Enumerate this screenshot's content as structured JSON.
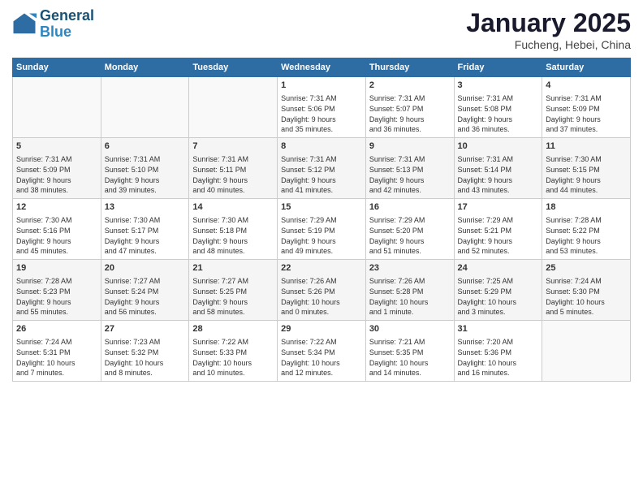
{
  "header": {
    "logo_line1": "General",
    "logo_line2": "Blue",
    "month": "January 2025",
    "location": "Fucheng, Hebei, China"
  },
  "days_of_week": [
    "Sunday",
    "Monday",
    "Tuesday",
    "Wednesday",
    "Thursday",
    "Friday",
    "Saturday"
  ],
  "weeks": [
    [
      {
        "day": "",
        "info": ""
      },
      {
        "day": "",
        "info": ""
      },
      {
        "day": "",
        "info": ""
      },
      {
        "day": "1",
        "info": "Sunrise: 7:31 AM\nSunset: 5:06 PM\nDaylight: 9 hours\nand 35 minutes."
      },
      {
        "day": "2",
        "info": "Sunrise: 7:31 AM\nSunset: 5:07 PM\nDaylight: 9 hours\nand 36 minutes."
      },
      {
        "day": "3",
        "info": "Sunrise: 7:31 AM\nSunset: 5:08 PM\nDaylight: 9 hours\nand 36 minutes."
      },
      {
        "day": "4",
        "info": "Sunrise: 7:31 AM\nSunset: 5:09 PM\nDaylight: 9 hours\nand 37 minutes."
      }
    ],
    [
      {
        "day": "5",
        "info": "Sunrise: 7:31 AM\nSunset: 5:09 PM\nDaylight: 9 hours\nand 38 minutes."
      },
      {
        "day": "6",
        "info": "Sunrise: 7:31 AM\nSunset: 5:10 PM\nDaylight: 9 hours\nand 39 minutes."
      },
      {
        "day": "7",
        "info": "Sunrise: 7:31 AM\nSunset: 5:11 PM\nDaylight: 9 hours\nand 40 minutes."
      },
      {
        "day": "8",
        "info": "Sunrise: 7:31 AM\nSunset: 5:12 PM\nDaylight: 9 hours\nand 41 minutes."
      },
      {
        "day": "9",
        "info": "Sunrise: 7:31 AM\nSunset: 5:13 PM\nDaylight: 9 hours\nand 42 minutes."
      },
      {
        "day": "10",
        "info": "Sunrise: 7:31 AM\nSunset: 5:14 PM\nDaylight: 9 hours\nand 43 minutes."
      },
      {
        "day": "11",
        "info": "Sunrise: 7:30 AM\nSunset: 5:15 PM\nDaylight: 9 hours\nand 44 minutes."
      }
    ],
    [
      {
        "day": "12",
        "info": "Sunrise: 7:30 AM\nSunset: 5:16 PM\nDaylight: 9 hours\nand 45 minutes."
      },
      {
        "day": "13",
        "info": "Sunrise: 7:30 AM\nSunset: 5:17 PM\nDaylight: 9 hours\nand 47 minutes."
      },
      {
        "day": "14",
        "info": "Sunrise: 7:30 AM\nSunset: 5:18 PM\nDaylight: 9 hours\nand 48 minutes."
      },
      {
        "day": "15",
        "info": "Sunrise: 7:29 AM\nSunset: 5:19 PM\nDaylight: 9 hours\nand 49 minutes."
      },
      {
        "day": "16",
        "info": "Sunrise: 7:29 AM\nSunset: 5:20 PM\nDaylight: 9 hours\nand 51 minutes."
      },
      {
        "day": "17",
        "info": "Sunrise: 7:29 AM\nSunset: 5:21 PM\nDaylight: 9 hours\nand 52 minutes."
      },
      {
        "day": "18",
        "info": "Sunrise: 7:28 AM\nSunset: 5:22 PM\nDaylight: 9 hours\nand 53 minutes."
      }
    ],
    [
      {
        "day": "19",
        "info": "Sunrise: 7:28 AM\nSunset: 5:23 PM\nDaylight: 9 hours\nand 55 minutes."
      },
      {
        "day": "20",
        "info": "Sunrise: 7:27 AM\nSunset: 5:24 PM\nDaylight: 9 hours\nand 56 minutes."
      },
      {
        "day": "21",
        "info": "Sunrise: 7:27 AM\nSunset: 5:25 PM\nDaylight: 9 hours\nand 58 minutes."
      },
      {
        "day": "22",
        "info": "Sunrise: 7:26 AM\nSunset: 5:26 PM\nDaylight: 10 hours\nand 0 minutes."
      },
      {
        "day": "23",
        "info": "Sunrise: 7:26 AM\nSunset: 5:28 PM\nDaylight: 10 hours\nand 1 minute."
      },
      {
        "day": "24",
        "info": "Sunrise: 7:25 AM\nSunset: 5:29 PM\nDaylight: 10 hours\nand 3 minutes."
      },
      {
        "day": "25",
        "info": "Sunrise: 7:24 AM\nSunset: 5:30 PM\nDaylight: 10 hours\nand 5 minutes."
      }
    ],
    [
      {
        "day": "26",
        "info": "Sunrise: 7:24 AM\nSunset: 5:31 PM\nDaylight: 10 hours\nand 7 minutes."
      },
      {
        "day": "27",
        "info": "Sunrise: 7:23 AM\nSunset: 5:32 PM\nDaylight: 10 hours\nand 8 minutes."
      },
      {
        "day": "28",
        "info": "Sunrise: 7:22 AM\nSunset: 5:33 PM\nDaylight: 10 hours\nand 10 minutes."
      },
      {
        "day": "29",
        "info": "Sunrise: 7:22 AM\nSunset: 5:34 PM\nDaylight: 10 hours\nand 12 minutes."
      },
      {
        "day": "30",
        "info": "Sunrise: 7:21 AM\nSunset: 5:35 PM\nDaylight: 10 hours\nand 14 minutes."
      },
      {
        "day": "31",
        "info": "Sunrise: 7:20 AM\nSunset: 5:36 PM\nDaylight: 10 hours\nand 16 minutes."
      },
      {
        "day": "",
        "info": ""
      }
    ]
  ]
}
